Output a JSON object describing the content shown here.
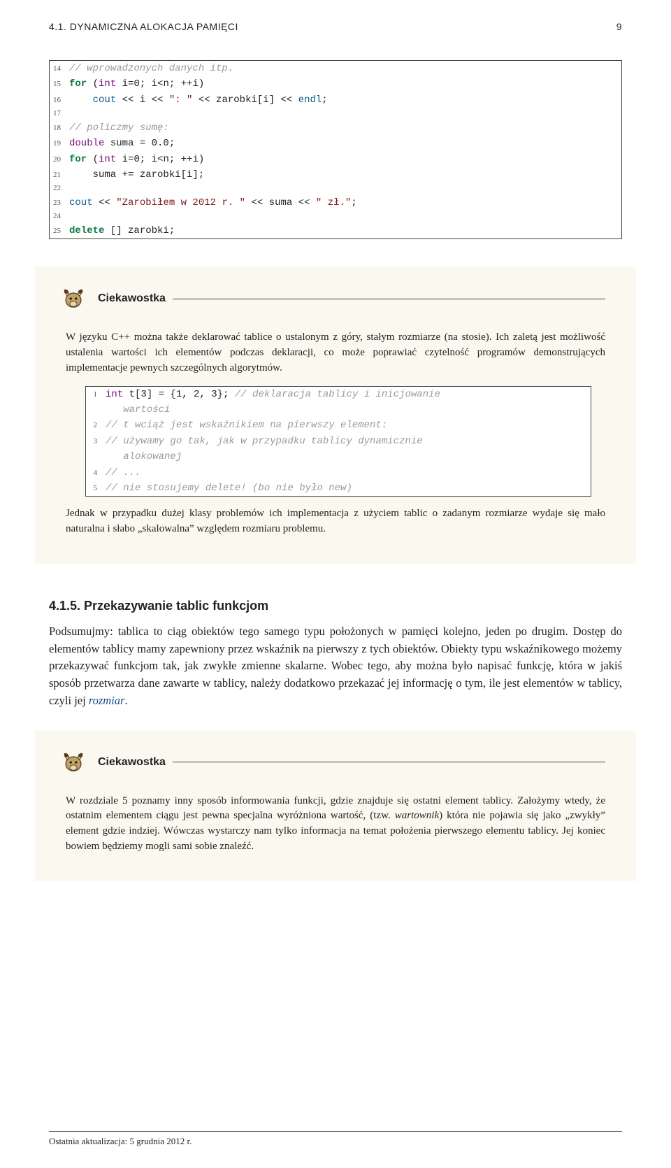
{
  "header": {
    "section_label": "4.1. DYNAMICZNA ALOKACJA PAMIĘCI",
    "page_number": "9"
  },
  "code1": {
    "lines": [
      {
        "n": "14",
        "html": "<span class='cm'>// wprowadzonych danych itp.</span>"
      },
      {
        "n": "15",
        "html": "<span class='kw'>for</span> (<span class='ty'>int</span> i=0; i&lt;n; ++i)"
      },
      {
        "n": "16",
        "html": "    <span class='fn'>cout</span> &lt;&lt; i &lt;&lt; <span class='str'>\": \"</span> &lt;&lt; zarobki[i] &lt;&lt; <span class='fn'>endl</span>;"
      },
      {
        "n": "17",
        "html": ""
      },
      {
        "n": "18",
        "html": "<span class='cm'>// policzmy sumę:</span>"
      },
      {
        "n": "19",
        "html": "<span class='ty'>double</span> suma = 0.0;"
      },
      {
        "n": "20",
        "html": "<span class='kw'>for</span> (<span class='ty'>int</span> i=0; i&lt;n; ++i)"
      },
      {
        "n": "21",
        "html": "    suma += zarobki[i];"
      },
      {
        "n": "22",
        "html": ""
      },
      {
        "n": "23",
        "html": "<span class='fn'>cout</span> &lt;&lt; <span class='str'>\"Zarobiłem w 2012 r. \"</span> &lt;&lt; suma &lt;&lt; <span class='str'>\" zł.\"</span>;"
      },
      {
        "n": "24",
        "html": ""
      },
      {
        "n": "25",
        "html": "<span class='kw'>delete</span> [] zarobki;"
      }
    ]
  },
  "callout1": {
    "title": "Ciekawostka",
    "para1": "W języku C++ można także deklarować tablice o ustalonym z góry, stałym rozmiarze (na stosie). Ich zaletą jest możliwość ustalenia wartości ich elementów podczas deklaracji, co może poprawiać czytelność programów demonstrujących implementacje pewnych szczególnych algorytmów.",
    "para2": "Jednak w przypadku dużej klasy problemów ich implementacja z użyciem tablic o zadanym rozmiarze wydaje się mało naturalna i słabo „skalowalna” względem rozmiaru problemu."
  },
  "code2": {
    "lines": [
      {
        "n": "1",
        "html": "<span class='ty'>int</span> t[3] = {1, 2, 3}; <span class='cm'>// deklaracja tablicy i inicjowanie</span>"
      },
      {
        "n": "",
        "html": "   <span class='cm'>wartości</span>"
      },
      {
        "n": "2",
        "html": "<span class='cm'>// t wciąż jest wskaźnikiem na pierwszy element:</span>"
      },
      {
        "n": "3",
        "html": "<span class='cm'>// używamy go tak, jak w przypadku tablicy dynamicznie</span>"
      },
      {
        "n": "",
        "html": "   <span class='cm'>alokowanej</span>"
      },
      {
        "n": "4",
        "html": "<span class='cm'>// ...</span>"
      },
      {
        "n": "5",
        "html": "<span class='cm'>// nie stosujemy delete! (bo nie było new)</span>"
      }
    ]
  },
  "section": {
    "heading": "4.1.5. Przekazywanie tablic funkcjom",
    "body_html": "Podsumujmy: tablica to ciąg obiektów tego samego typu położonych w pamięci kolejno, jeden po drugim. Dostęp do elementów tablicy mamy zapewniony przez wskaźnik na pierwszy z tych obiektów. Obiekty typu wskaźnikowego możemy przekazywać funkcjom tak, jak zwykłe zmienne skalarne. Wobec tego, aby można było napisać funkcję, która w jakiś sposób przetwarza dane zawarte w tablicy, należy dodatkowo przekazać jej informację o tym, ile jest elementów w tablicy, czyli jej <span class='term'>rozmiar</span>."
  },
  "callout2": {
    "title": "Ciekawostka",
    "para1_html": "W rozdziale 5 poznamy inny sposób informowania funkcji, gdzie znajduje się ostatni element tablicy. Założymy wtedy, że ostatnim elementem ciągu jest pewna specjalna wyróżniona wartość, (tzw. <i>wartownik</i>) która nie pojawia się jako „zwykły” element gdzie indziej. Wówczas wystarczy nam tylko informacja na temat położenia pierwszego elementu tablicy. Jej koniec bowiem będziemy mogli sami sobie znaleźć."
  },
  "footer": {
    "text": "Ostatnia aktualizacja: 5 grudnia 2012 r."
  }
}
